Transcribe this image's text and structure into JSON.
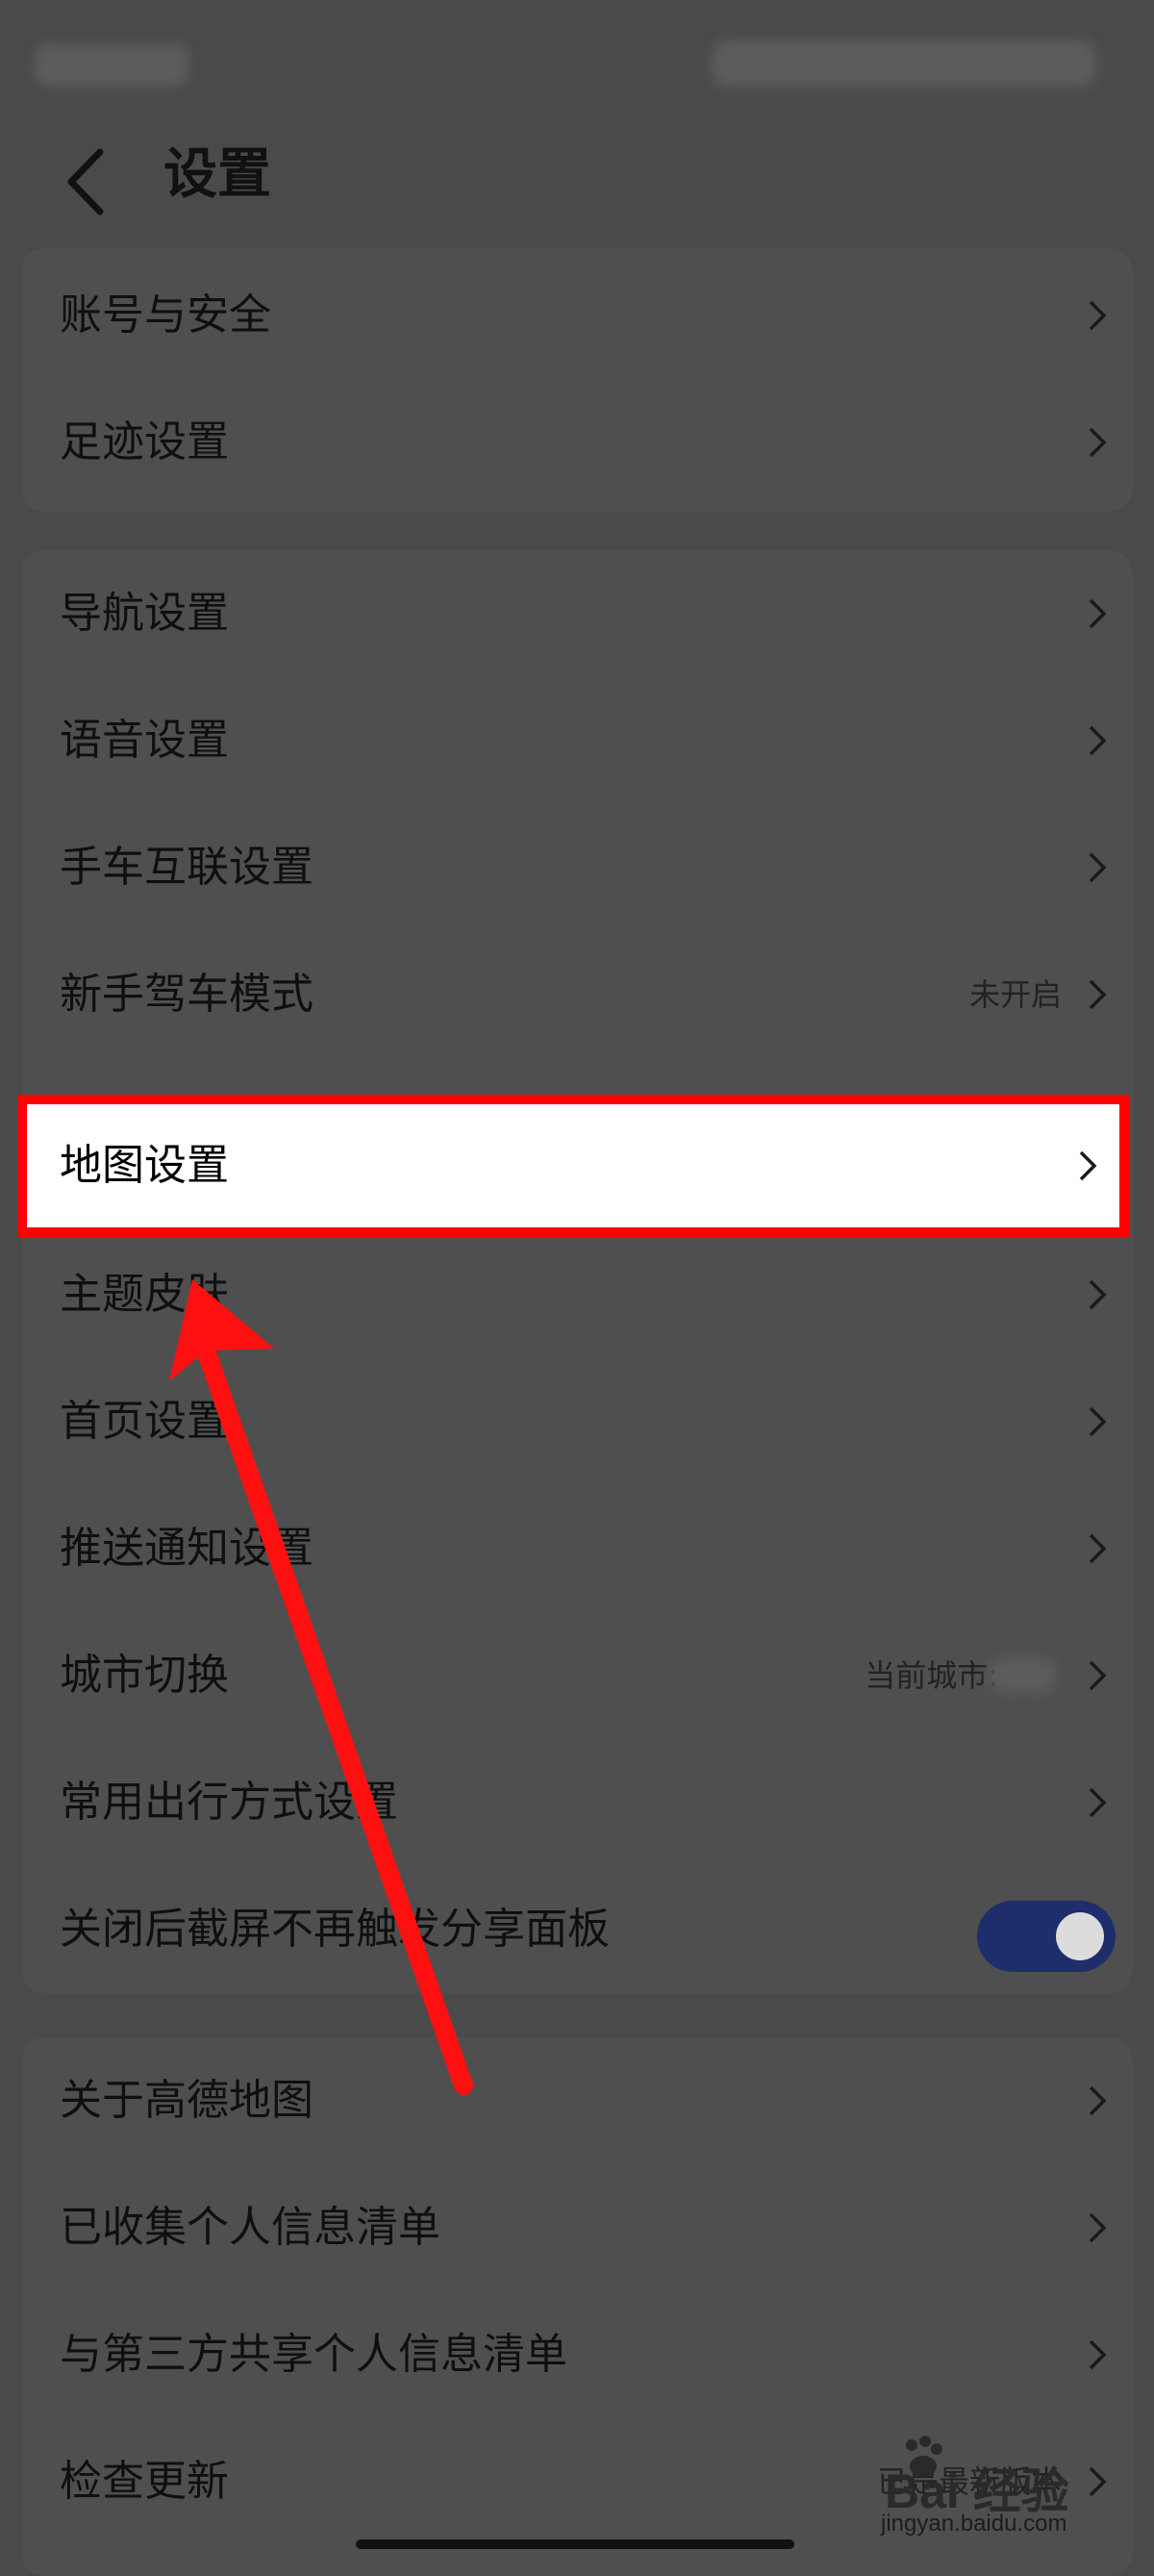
{
  "header": {
    "title": "设置"
  },
  "groups": [
    {
      "items": [
        {
          "label": "账号与安全"
        },
        {
          "label": "足迹设置"
        }
      ]
    },
    {
      "items": [
        {
          "label": "导航设置"
        },
        {
          "label": "语音设置"
        },
        {
          "label": "手车互联设置"
        },
        {
          "label": "新手驾车模式",
          "value": "未开启"
        },
        {
          "label": "地图设置",
          "highlighted": true
        },
        {
          "label": "主题皮肤"
        },
        {
          "label": "首页设置"
        },
        {
          "label": "推送通知设置"
        },
        {
          "label": "城市切换",
          "value": "当前城市:"
        },
        {
          "label": "常用出行方式设置"
        },
        {
          "label": "关闭后截屏不再触发分享面板",
          "toggle": true
        }
      ]
    },
    {
      "items": [
        {
          "label": "关于高德地图"
        },
        {
          "label": "已收集个人信息清单"
        },
        {
          "label": "与第三方共享个人信息清单"
        },
        {
          "label": "检查更新",
          "value": "已是最新版本"
        }
      ]
    }
  ],
  "watermark": {
    "main": "Bai 经验",
    "sub": "jingyan.baidu.com"
  },
  "colors": {
    "highlight_border": "#ff0000",
    "arrow": "#ff1010",
    "toggle_on": "#1e2d6b"
  },
  "icons": {
    "back": "chevron-left-icon",
    "row_arrow": "chevron-right-icon"
  }
}
